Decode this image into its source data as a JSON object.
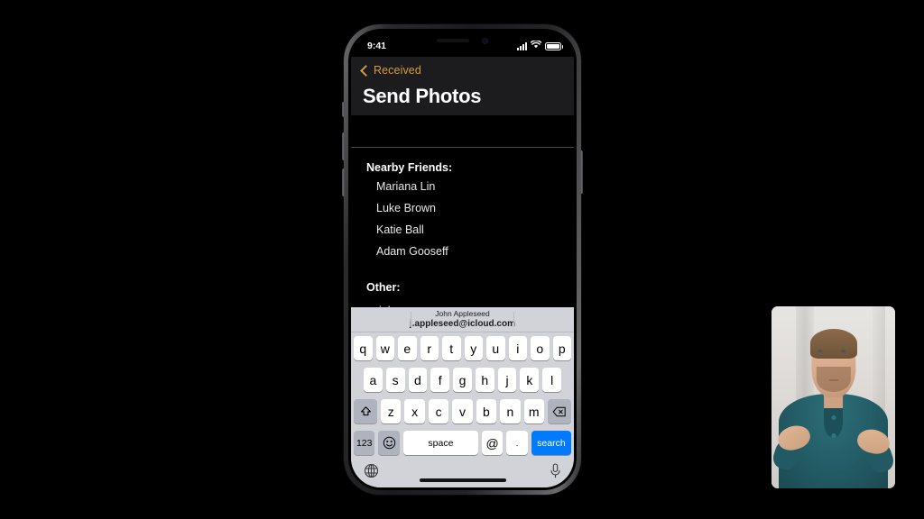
{
  "app": {
    "title": "Send Photos"
  },
  "status_bar": {
    "time": "9:41",
    "cellular_icon": "signal-bars-icon",
    "wifi_icon": "wifi-icon",
    "battery_icon": "battery-icon"
  },
  "nav": {
    "back_label": "Received",
    "back_icon": "chevron-left-icon",
    "accent_color": "#d59a42"
  },
  "content": {
    "section_nearby_label": "Nearby Friends:",
    "nearby_friends": [
      "Mariana Lin",
      "Luke Brown",
      "Katie Ball",
      "Adam Gooseff"
    ],
    "section_other_label": "Other:",
    "other_entry_value": "joh",
    "other_entry_placeholder": ""
  },
  "keyboard": {
    "prediction": {
      "name": "John Appleseed",
      "email": "j.appleseed@icloud.com"
    },
    "row1": [
      "q",
      "w",
      "e",
      "r",
      "t",
      "y",
      "u",
      "i",
      "o",
      "p"
    ],
    "row2": [
      "a",
      "s",
      "d",
      "f",
      "g",
      "h",
      "j",
      "k",
      "l"
    ],
    "row3": [
      "z",
      "x",
      "c",
      "v",
      "b",
      "n",
      "m"
    ],
    "shift_icon": "shift-up-icon",
    "backspace_icon": "backspace-delete-icon",
    "numbers_key": "123",
    "emoji_icon": "emoji-smiley-icon",
    "space_key": "space",
    "at_key": "@",
    "period_key": ".",
    "return_key": "search",
    "return_key_color": "#007aff",
    "globe_icon": "globe-keyboard-switch-icon",
    "mic_icon": "microphone-dictation-icon",
    "background_color": "#d1d3d9",
    "key_color": "#ffffff",
    "modifier_key_color": "#aeb3bd"
  },
  "presenter": {
    "label": "presenter-video-inset"
  }
}
